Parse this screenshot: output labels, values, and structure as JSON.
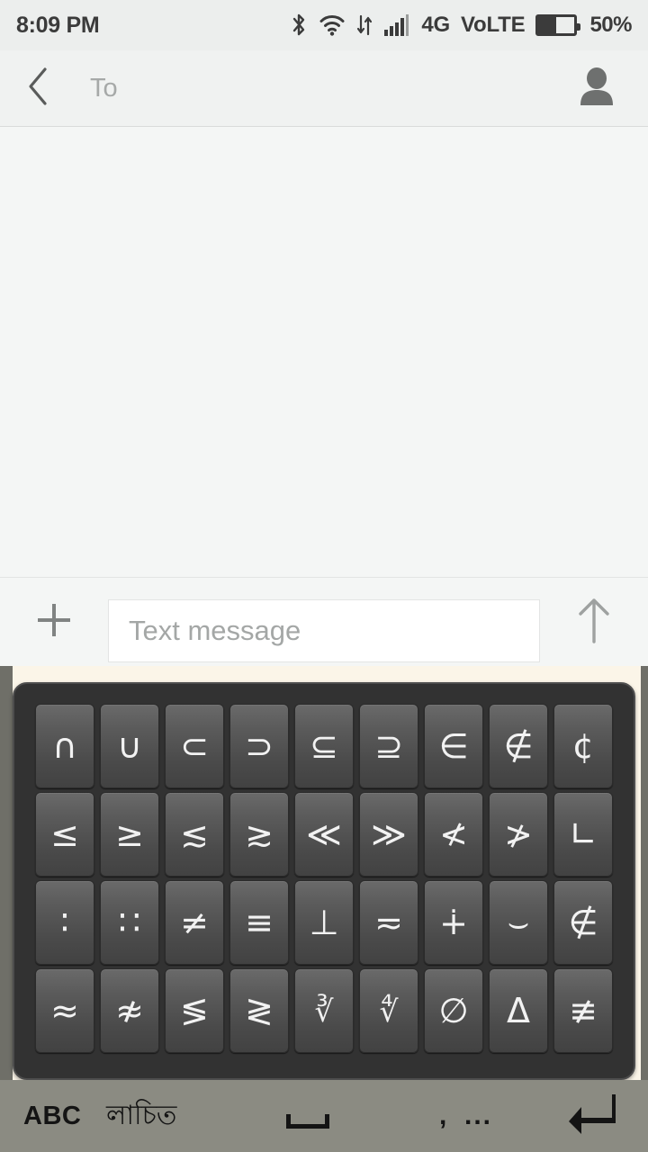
{
  "status_bar": {
    "time": "8:09 PM",
    "bluetooth_icon": "bluetooth-icon",
    "wifi_icon": "wifi-icon",
    "data_transfer_icon": "data-transfer-icon",
    "signal_icon": "signal-bars-icon",
    "network_type": "4G",
    "volte_label": "VoLTE",
    "battery_icon": "battery-icon",
    "battery_percent": "50%",
    "battery_level": 50,
    "colors": {
      "background": "#eceeed",
      "foreground": "#3b3b3b"
    }
  },
  "nav_bar": {
    "back_icon": "back-chevron-icon",
    "recipient_placeholder": "To",
    "contact_icon": "contact-person-icon",
    "colors": {
      "background": "#f0f2f1",
      "placeholder": "#a6a9a8"
    }
  },
  "conversation": {
    "messages": [],
    "background": "#f4f6f5"
  },
  "compose": {
    "attach_icon": "plus-attach-icon",
    "input_value": "",
    "input_placeholder": "Text message",
    "send_icon": "send-arrow-up-icon",
    "colors": {
      "field_background": "#ffffff",
      "placeholder": "#a4a7a6"
    }
  },
  "keyboard": {
    "layout_name": "math-symbols",
    "panel_color": "#323232",
    "key_text_color": "#f2f2f2",
    "rows": [
      {
        "name": "row-1",
        "keys": [
          {
            "glyph": "∩",
            "name": "key-intersection"
          },
          {
            "glyph": "∪",
            "name": "key-union"
          },
          {
            "glyph": "⊂",
            "name": "key-subset-of"
          },
          {
            "glyph": "⊃",
            "name": "key-superset-of"
          },
          {
            "glyph": "⊆",
            "name": "key-subset-or-equal"
          },
          {
            "glyph": "⊇",
            "name": "key-superset-or-equal"
          },
          {
            "glyph": "∈",
            "name": "key-element-of"
          },
          {
            "glyph": "∉",
            "name": "key-not-element-of"
          },
          {
            "glyph": "¢",
            "name": "key-cent-sign"
          }
        ]
      },
      {
        "name": "row-2",
        "keys": [
          {
            "glyph": "≤",
            "name": "key-less-than-or-equal"
          },
          {
            "glyph": "≥",
            "name": "key-greater-than-or-equal"
          },
          {
            "glyph": "≲",
            "name": "key-less-than-or-equivalent"
          },
          {
            "glyph": "≳",
            "name": "key-greater-than-or-equivalent"
          },
          {
            "glyph": "≪",
            "name": "key-much-less-than"
          },
          {
            "glyph": "≫",
            "name": "key-much-greater-than"
          },
          {
            "glyph": "≮",
            "name": "key-not-less-than"
          },
          {
            "glyph": "≯",
            "name": "key-not-greater-than"
          },
          {
            "glyph": "∟",
            "name": "key-right-angle"
          }
        ]
      },
      {
        "name": "row-3",
        "keys": [
          {
            "glyph": "∶",
            "name": "key-ratio"
          },
          {
            "glyph": "∷",
            "name": "key-proportion"
          },
          {
            "glyph": "≠",
            "name": "key-not-equal"
          },
          {
            "glyph": "≡",
            "name": "key-identical-to"
          },
          {
            "glyph": "⊥",
            "name": "key-perpendicular"
          },
          {
            "glyph": "≂",
            "name": "key-plus-with-tilde-below"
          },
          {
            "glyph": "∔",
            "name": "key-plus-with-tilde-above"
          },
          {
            "glyph": "⌣",
            "name": "key-smile-arc"
          },
          {
            "glyph": "∉",
            "name": "key-not-element-of-slashed-c"
          }
        ]
      },
      {
        "name": "row-4",
        "keys": [
          {
            "glyph": "≈",
            "name": "key-almost-equal"
          },
          {
            "glyph": "≉",
            "name": "key-not-almost-equal"
          },
          {
            "glyph": "≶",
            "name": "key-less-or-greater"
          },
          {
            "glyph": "≷",
            "name": "key-greater-or-less"
          },
          {
            "glyph": "∛",
            "name": "key-cube-root"
          },
          {
            "glyph": "∜",
            "name": "key-fourth-root"
          },
          {
            "glyph": "∅",
            "name": "key-empty-set"
          },
          {
            "glyph": "Δ",
            "name": "key-delta"
          },
          {
            "glyph": "≢",
            "name": "key-not-identical-to"
          }
        ]
      }
    ],
    "bottom_bar": {
      "abc_label": "ABC",
      "language_label": "লাচিত",
      "space_icon": "space-bar-icon",
      "comma_label": ",",
      "ellipsis_label": "...",
      "enter_icon": "enter-return-icon",
      "background": "#8b8b82"
    }
  }
}
